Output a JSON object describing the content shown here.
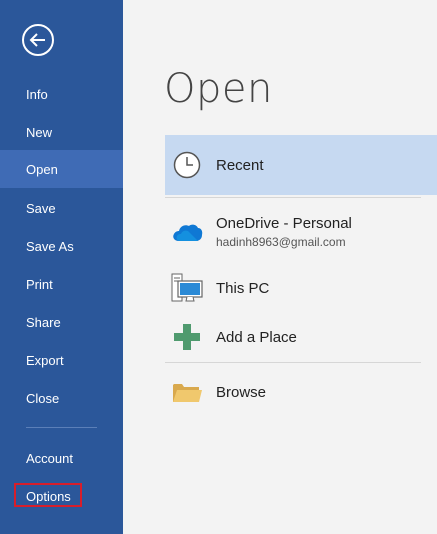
{
  "sidebar": {
    "back_icon": "back-arrow-icon",
    "items": [
      {
        "label": "Info",
        "active": false
      },
      {
        "label": "New",
        "active": false
      },
      {
        "label": "Open",
        "active": true
      },
      {
        "label": "Save",
        "active": false
      },
      {
        "label": "Save As",
        "active": false
      },
      {
        "label": "Print",
        "active": false
      },
      {
        "label": "Share",
        "active": false
      },
      {
        "label": "Export",
        "active": false
      },
      {
        "label": "Close",
        "active": false
      }
    ],
    "bottom_items": [
      {
        "label": "Account"
      },
      {
        "label": "Options"
      }
    ],
    "highlight_color": "#d81e2b",
    "color": "#2b579a"
  },
  "main": {
    "title": "Open",
    "locations": [
      {
        "label": "Recent",
        "icon": "clock-icon",
        "selected": true
      },
      {
        "label": "OneDrive - Personal",
        "sub": "hadinh8963@gmail.com",
        "icon": "onedrive-cloud-icon"
      },
      {
        "label": "This PC",
        "icon": "computer-icon"
      },
      {
        "label": "Add a Place",
        "icon": "plus-icon"
      },
      {
        "label": "Browse",
        "icon": "folder-icon"
      }
    ]
  }
}
